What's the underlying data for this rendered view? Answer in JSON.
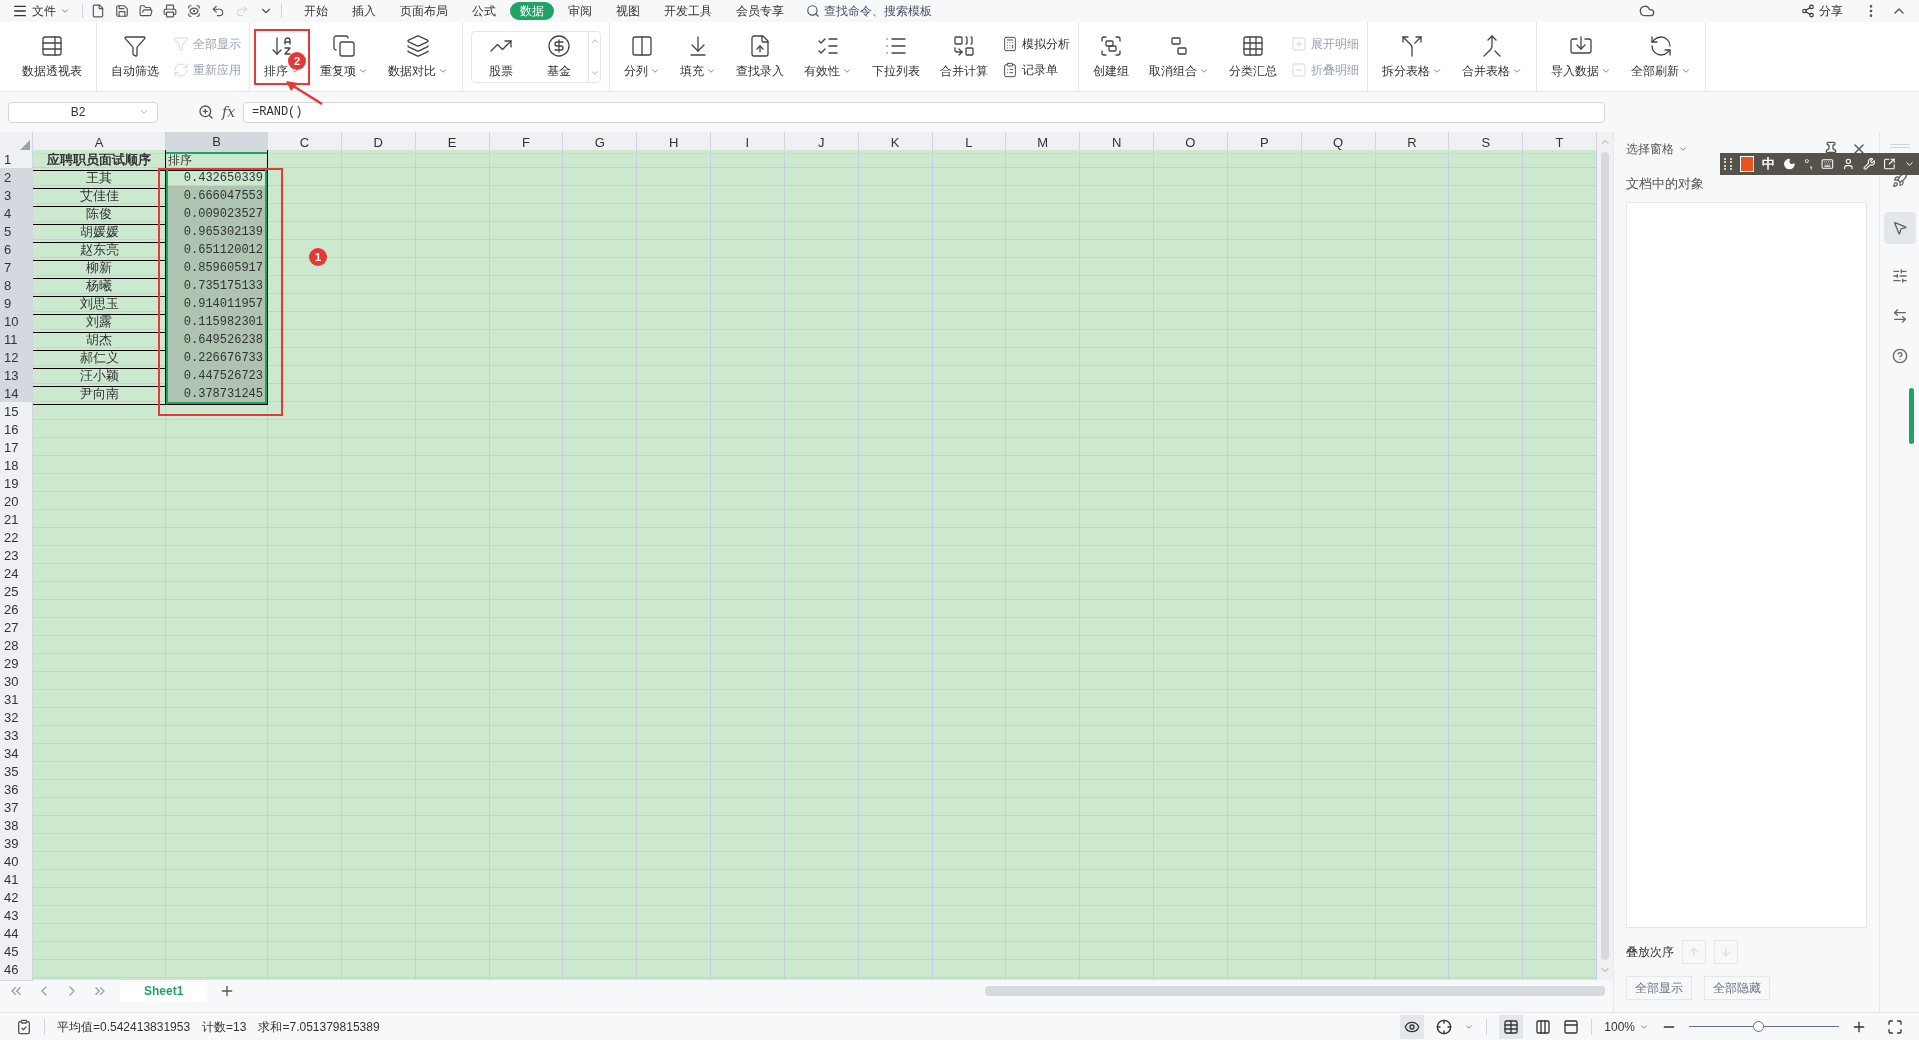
{
  "menu": {
    "file": "文件",
    "tabs": [
      {
        "label": "开始",
        "selected": false
      },
      {
        "label": "插入",
        "selected": false
      },
      {
        "label": "页面布局",
        "selected": false
      },
      {
        "label": "公式",
        "selected": false
      },
      {
        "label": "数据",
        "selected": true
      },
      {
        "label": "审阅",
        "selected": false
      },
      {
        "label": "视图",
        "selected": false
      },
      {
        "label": "开发工具",
        "selected": false
      },
      {
        "label": "会员专享",
        "selected": false
      }
    ],
    "search": {
      "placeholder": "查找命令、搜索模板"
    },
    "share": "分享"
  },
  "ribbon": [
    {
      "items": [
        {
          "kind": "large",
          "label": "数据透视表",
          "dropdown": false,
          "disabled": false,
          "highlighted": false
        }
      ]
    },
    {
      "items": [
        {
          "kind": "large",
          "label": "自动筛选",
          "dropdown": false,
          "disabled": false,
          "highlighted": false
        },
        {
          "kind": "stack",
          "items": [
            {
              "label": "全部显示",
              "disabled": true
            },
            {
              "label": "重新应用",
              "disabled": true
            }
          ]
        }
      ]
    },
    {
      "items": [
        {
          "kind": "large",
          "label": "排序",
          "dropdown": true,
          "disabled": false,
          "highlighted": true
        },
        {
          "kind": "large",
          "label": "重复项",
          "dropdown": true,
          "disabled": false,
          "highlighted": false
        },
        {
          "kind": "large",
          "label": "数据对比",
          "dropdown": true,
          "disabled": false,
          "highlighted": false
        }
      ]
    },
    {
      "items": [
        {
          "kind": "gallery",
          "items": [
            {
              "label": "股票"
            },
            {
              "label": "基金"
            }
          ]
        }
      ]
    },
    {
      "items": [
        {
          "kind": "large",
          "label": "分列",
          "dropdown": true,
          "disabled": false,
          "highlighted": false
        },
        {
          "kind": "large",
          "label": "填充",
          "dropdown": true,
          "disabled": false,
          "highlighted": false
        },
        {
          "kind": "large",
          "label": "查找录入",
          "dropdown": false,
          "disabled": false,
          "highlighted": false
        },
        {
          "kind": "large",
          "label": "有效性",
          "dropdown": true,
          "disabled": false,
          "highlighted": false
        },
        {
          "kind": "large",
          "label": "下拉列表",
          "dropdown": false,
          "disabled": false,
          "highlighted": false
        },
        {
          "kind": "large",
          "label": "合并计算",
          "dropdown": false,
          "disabled": false,
          "highlighted": false
        },
        {
          "kind": "stack",
          "items": [
            {
              "label": "模拟分析",
              "disabled": false
            },
            {
              "label": "记录单",
              "disabled": false
            }
          ]
        }
      ]
    },
    {
      "items": [
        {
          "kind": "large",
          "label": "创建组",
          "dropdown": false,
          "disabled": false,
          "highlighted": false
        },
        {
          "kind": "large",
          "label": "取消组合",
          "dropdown": true,
          "disabled": false,
          "highlighted": false
        },
        {
          "kind": "large",
          "label": "分类汇总",
          "dropdown": false,
          "disabled": false,
          "highlighted": false
        },
        {
          "kind": "stack",
          "items": [
            {
              "label": "展开明细",
              "disabled": true
            },
            {
              "label": "折叠明细",
              "disabled": true
            }
          ]
        }
      ]
    },
    {
      "items": [
        {
          "kind": "large",
          "label": "拆分表格",
          "dropdown": true,
          "disabled": false,
          "highlighted": false
        },
        {
          "kind": "large",
          "label": "合并表格",
          "dropdown": true,
          "disabled": false,
          "highlighted": false
        }
      ]
    },
    {
      "items": [
        {
          "kind": "large",
          "label": "导入数据",
          "dropdown": true,
          "disabled": false,
          "highlighted": false
        },
        {
          "kind": "large",
          "label": "全部刷新",
          "dropdown": true,
          "disabled": false,
          "highlighted": false
        }
      ]
    }
  ],
  "name_box": "B2",
  "fx": "fx",
  "formula": "=RAND()",
  "columns": [
    {
      "label": "A",
      "selected": false
    },
    {
      "label": "B",
      "selected": true
    },
    {
      "label": "C",
      "selected": false
    },
    {
      "label": "D",
      "selected": false
    },
    {
      "label": "E",
      "selected": false
    },
    {
      "label": "F",
      "selected": false
    },
    {
      "label": "G",
      "selected": false
    },
    {
      "label": "H",
      "selected": false
    },
    {
      "label": "I",
      "selected": false
    },
    {
      "label": "J",
      "selected": false
    },
    {
      "label": "K",
      "selected": false
    },
    {
      "label": "L",
      "selected": false
    },
    {
      "label": "M",
      "selected": false
    },
    {
      "label": "N",
      "selected": false
    },
    {
      "label": "O",
      "selected": false
    },
    {
      "label": "P",
      "selected": false
    },
    {
      "label": "Q",
      "selected": false
    },
    {
      "label": "R",
      "selected": false
    },
    {
      "label": "S",
      "selected": false
    },
    {
      "label": "T",
      "selected": false
    }
  ],
  "rows": [
    {
      "label": "1",
      "selected": false
    },
    {
      "label": "2",
      "selected": true
    },
    {
      "label": "3",
      "selected": true
    },
    {
      "label": "4",
      "selected": true
    },
    {
      "label": "5",
      "selected": true
    },
    {
      "label": "6",
      "selected": true
    },
    {
      "label": "7",
      "selected": true
    },
    {
      "label": "8",
      "selected": true
    },
    {
      "label": "9",
      "selected": true
    },
    {
      "label": "10",
      "selected": true
    },
    {
      "label": "11",
      "selected": true
    },
    {
      "label": "12",
      "selected": true
    },
    {
      "label": "13",
      "selected": true
    },
    {
      "label": "14",
      "selected": true
    },
    {
      "label": "15",
      "selected": false
    },
    {
      "label": "16",
      "selected": false
    },
    {
      "label": "17",
      "selected": false
    },
    {
      "label": "18",
      "selected": false
    },
    {
      "label": "19",
      "selected": false
    },
    {
      "label": "20",
      "selected": false
    },
    {
      "label": "21",
      "selected": false
    },
    {
      "label": "22",
      "selected": false
    },
    {
      "label": "23",
      "selected": false
    },
    {
      "label": "24",
      "selected": false
    },
    {
      "label": "25",
      "selected": false
    },
    {
      "label": "26",
      "selected": false
    },
    {
      "label": "27",
      "selected": false
    },
    {
      "label": "28",
      "selected": false
    },
    {
      "label": "29",
      "selected": false
    },
    {
      "label": "30",
      "selected": false
    },
    {
      "label": "31",
      "selected": false
    },
    {
      "label": "32",
      "selected": false
    },
    {
      "label": "33",
      "selected": false
    },
    {
      "label": "34",
      "selected": false
    },
    {
      "label": "35",
      "selected": false
    },
    {
      "label": "36",
      "selected": false
    },
    {
      "label": "37",
      "selected": false
    },
    {
      "label": "38",
      "selected": false
    },
    {
      "label": "39",
      "selected": false
    },
    {
      "label": "40",
      "selected": false
    },
    {
      "label": "41",
      "selected": false
    },
    {
      "label": "42",
      "selected": false
    },
    {
      "label": "43",
      "selected": false
    },
    {
      "label": "44",
      "selected": false
    },
    {
      "label": "45",
      "selected": false
    },
    {
      "label": "46",
      "selected": false
    }
  ],
  "cells": [
    {
      "a": "应聘职员面试顺序",
      "b": "排序",
      "selected": false,
      "active": false
    },
    {
      "a": "王其",
      "b": "0.432650339",
      "selected": true,
      "active": true
    },
    {
      "a": "艾佳佳",
      "b": "0.666047553",
      "selected": true,
      "active": false
    },
    {
      "a": "陈俊",
      "b": "0.009023527",
      "selected": true,
      "active": false
    },
    {
      "a": "胡媛媛",
      "b": "0.965302139",
      "selected": true,
      "active": false
    },
    {
      "a": "赵东亮",
      "b": "0.651120012",
      "selected": true,
      "active": false
    },
    {
      "a": "柳新",
      "b": "0.859605917",
      "selected": true,
      "active": false
    },
    {
      "a": "杨曦",
      "b": "0.735175133",
      "selected": true,
      "active": false
    },
    {
      "a": "刘思玉",
      "b": "0.914011957",
      "selected": true,
      "active": false
    },
    {
      "a": "刘露",
      "b": "0.115982301",
      "selected": true,
      "active": false
    },
    {
      "a": "胡杰",
      "b": "0.649526238",
      "selected": true,
      "active": false
    },
    {
      "a": "郝仁义",
      "b": "0.226676733",
      "selected": true,
      "active": false
    },
    {
      "a": "汪小颖",
      "b": "0.447526723",
      "selected": true,
      "active": false
    },
    {
      "a": "尹向南",
      "b": "0.378731245",
      "selected": true,
      "active": false
    }
  ],
  "annotations": [
    {
      "label": "1"
    },
    {
      "label": "2"
    }
  ],
  "sheet_tabs": [
    {
      "label": "Sheet1",
      "selected": true
    }
  ],
  "status": [
    "平均值=0.542413831953",
    "计数=13",
    "求和=7.051379815389"
  ],
  "zoom": {
    "reading": "100%",
    "level": 0.46
  },
  "side_panel": {
    "title": "选择窗格",
    "objects_label": "文档中的对象",
    "order_label": "叠放次序",
    "buttons": [
      {
        "label": "全部显示",
        "disabled": true
      },
      {
        "label": "全部隐藏",
        "disabled": true
      }
    ]
  },
  "ime": {
    "mode": "中",
    "punct": "°,"
  }
}
